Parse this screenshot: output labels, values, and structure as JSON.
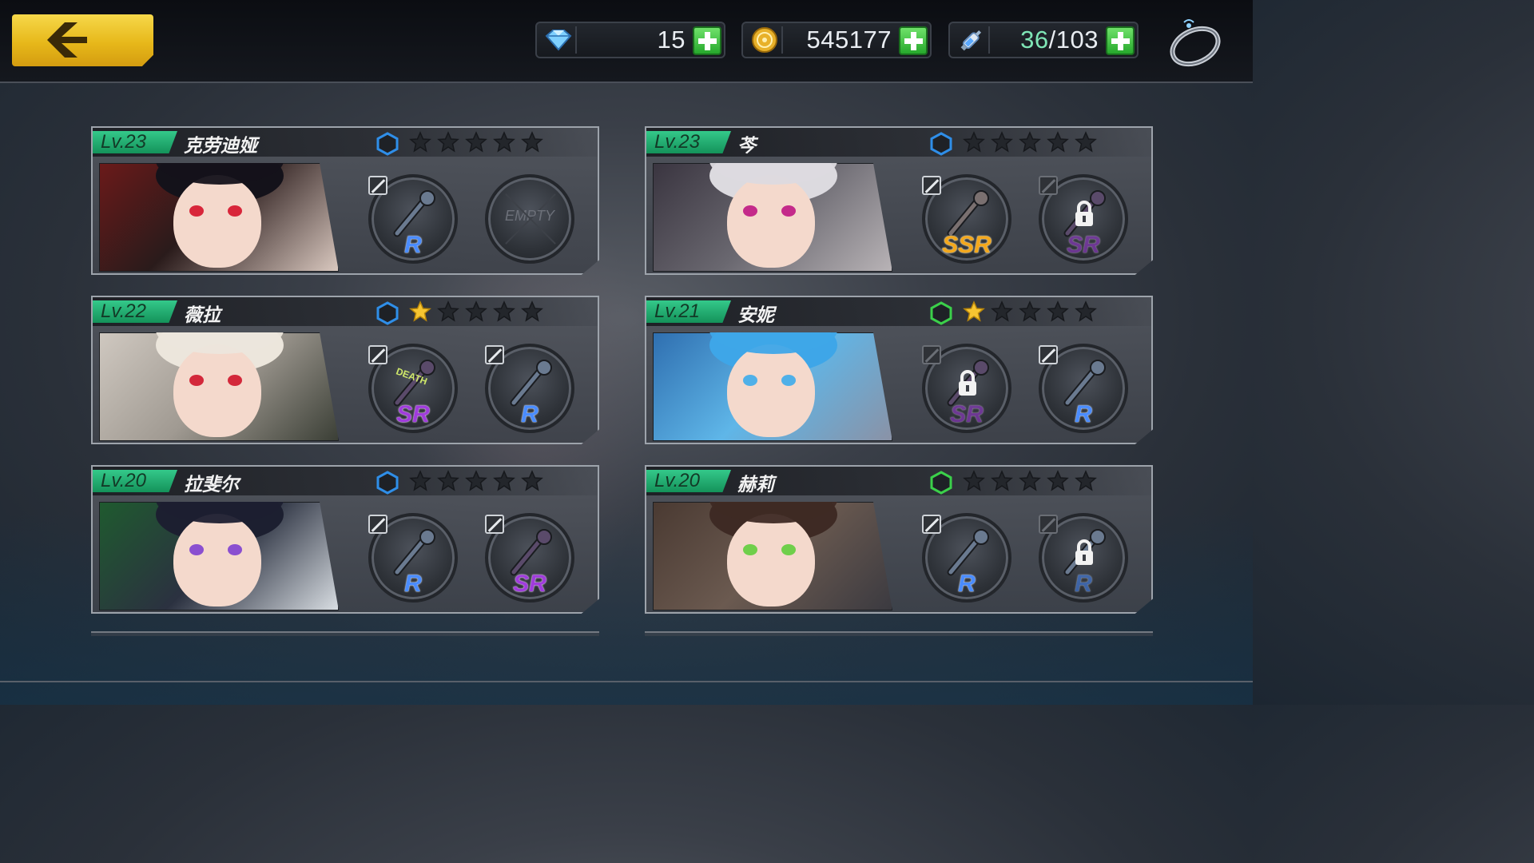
{
  "topbar": {
    "back_icon": "back-arrow-icon",
    "gems": {
      "icon": "diamond-icon",
      "value": "15"
    },
    "coins": {
      "icon": "coin-icon",
      "value": "545177"
    },
    "stamina": {
      "icon": "syringe-icon",
      "current": "36",
      "separator": "/",
      "max": "103"
    },
    "ring_icon": "ring-icon"
  },
  "colors": {
    "accent_green": "#34c98a",
    "rarity_r": "#4a8cff",
    "rarity_sr": "#a03cdc",
    "rarity_ssr": "#f4a81c",
    "back_button": "#f0c62a"
  },
  "characters": [
    {
      "level": "Lv.23",
      "name": "克劳迪娅",
      "element": "blue",
      "stars": 0,
      "slots": [
        {
          "rarity": "R",
          "item": "rose-scepter-icon",
          "locked": false,
          "editable": true
        },
        {
          "empty_label": "EMPTY",
          "item": "",
          "locked": false,
          "editable": false,
          "empty": true
        }
      ]
    },
    {
      "level": "Lv.23",
      "name": "芩",
      "element": "blue",
      "stars": 0,
      "slots": [
        {
          "rarity": "SSR",
          "item": "twin-katana-icon",
          "locked": false,
          "editable": true
        },
        {
          "rarity": "SR",
          "item": "dark-blade-icon",
          "locked": true,
          "editable": false
        }
      ]
    },
    {
      "level": "Lv.22",
      "name": "薇拉",
      "element": "blue",
      "stars": 1,
      "slots": [
        {
          "rarity": "SR",
          "item": "death-cannon-icon",
          "locked": false,
          "editable": true,
          "item_text": "DEATH"
        },
        {
          "rarity": "R",
          "item": "blaster-gun-icon",
          "locked": false,
          "editable": true
        }
      ]
    },
    {
      "level": "Lv.21",
      "name": "安妮",
      "element": "green",
      "stars": 1,
      "slots": [
        {
          "rarity": "SR",
          "item": "camera-icon",
          "locked": true,
          "editable": false
        },
        {
          "rarity": "R",
          "item": "key-staff-icon",
          "locked": false,
          "editable": true
        }
      ]
    },
    {
      "level": "Lv.20",
      "name": "拉斐尔",
      "element": "blue",
      "stars": 0,
      "slots": [
        {
          "rarity": "R",
          "item": "flower-wand-icon",
          "locked": false,
          "editable": true
        },
        {
          "rarity": "SR",
          "item": "thorn-chain-icon",
          "locked": false,
          "editable": true
        }
      ]
    },
    {
      "level": "Lv.20",
      "name": "赫莉",
      "element": "green",
      "stars": 0,
      "slots": [
        {
          "rarity": "R",
          "item": "crossbow-icon",
          "locked": false,
          "editable": true
        },
        {
          "rarity": "R",
          "item": "chainsaw-icon",
          "locked": true,
          "editable": false
        }
      ]
    }
  ]
}
